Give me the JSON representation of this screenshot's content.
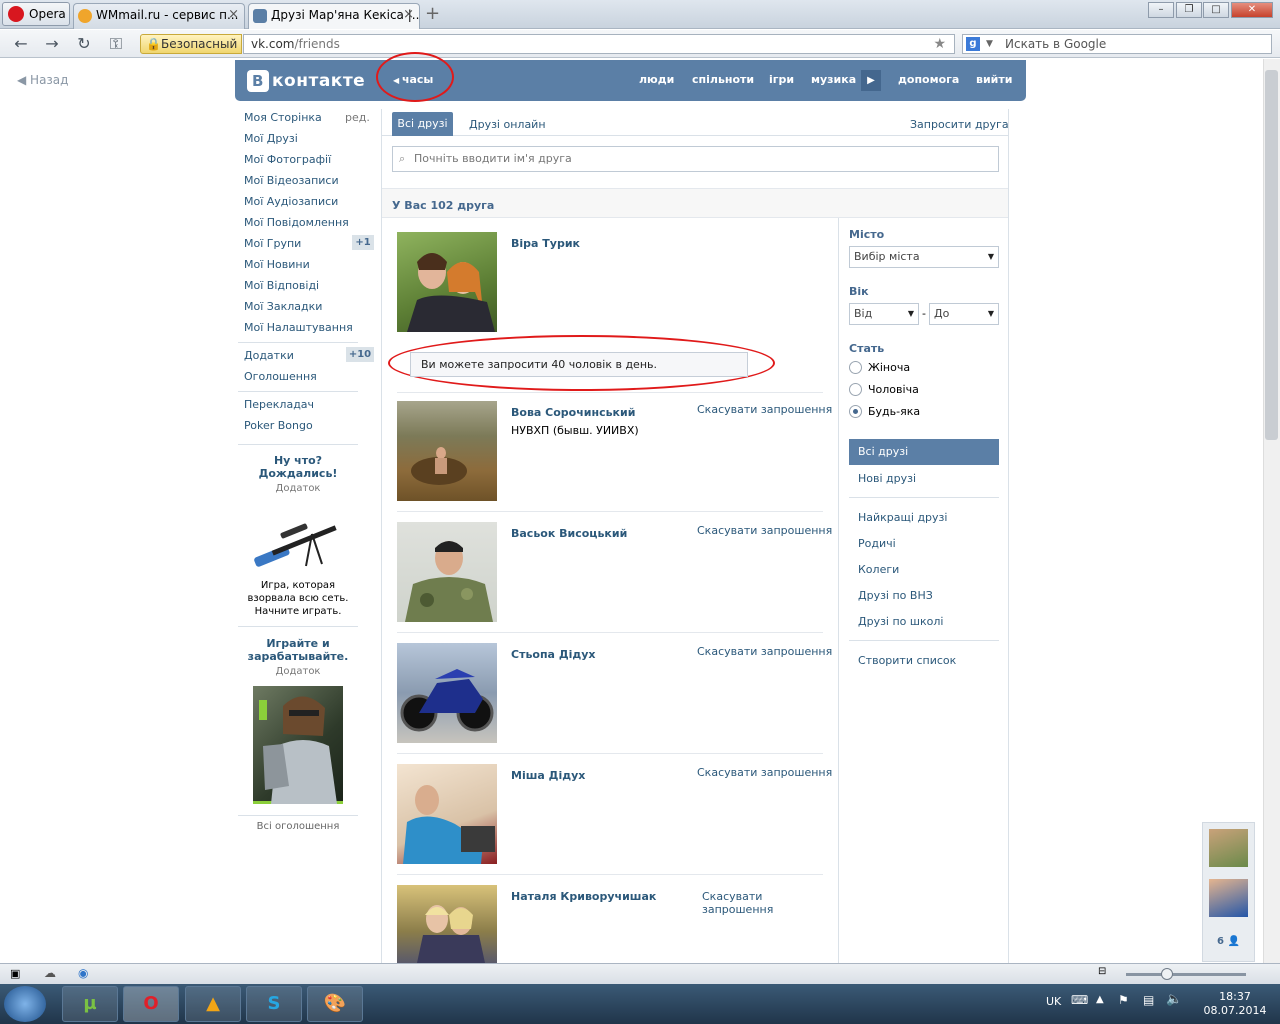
{
  "browser": {
    "opera_button": "Opera",
    "tabs": [
      {
        "label": "WMmail.ru - сервис п..."
      },
      {
        "label": "Друзі Мар'яна Кекіса |..."
      }
    ],
    "secure_label": "Безопасный",
    "address_domain": "vk.com",
    "address_path": "/friends",
    "search_placeholder": "Искать в Google"
  },
  "page": {
    "back_label": "Назад",
    "logo_text": "контакте",
    "logo_letter": "В",
    "status_text": "часы",
    "top_nav": [
      "люди",
      "спільноти",
      "ігри",
      "музика",
      "допомога",
      "вийти"
    ]
  },
  "left_menu": {
    "items": [
      {
        "label": "Моя Сторінка",
        "extra": "ред."
      },
      {
        "label": "Мої Друзі"
      },
      {
        "label": "Мої Фотографії"
      },
      {
        "label": "Мої Відеозаписи"
      },
      {
        "label": "Мої Аудіозаписи"
      },
      {
        "label": "Мої Повідомлення"
      },
      {
        "label": "Мої Групи",
        "badge": "+1"
      },
      {
        "label": "Мої Новини"
      },
      {
        "label": "Мої Відповіді"
      },
      {
        "label": "Мої Закладки"
      },
      {
        "label": "Мої Налаштування"
      }
    ],
    "apps": [
      {
        "label": "Додатки",
        "badge": "+10"
      },
      {
        "label": "Оголошення"
      }
    ],
    "extra": [
      {
        "label": "Перекладач"
      },
      {
        "label": "Poker Bongo"
      }
    ],
    "ads": [
      {
        "title": "Ну что? Дождались!",
        "sub": "Додаток",
        "text": "Игра, которая взорвала всю сеть. Начните играть."
      },
      {
        "title": "Играйте и зарабатывайте.",
        "sub": "Додаток"
      }
    ],
    "all_ads": "Всі оголошення"
  },
  "friends": {
    "tab_all": "Всі друзі",
    "tab_online": "Друзі онлайн",
    "invite_link": "Запросити друга",
    "search_placeholder": "Почніть вводити ім'я друга",
    "count_text": "У Вас 102 друга",
    "notice": "Ви можете запросити 40 чоловік в день.",
    "list": [
      {
        "name": "Віра Турик",
        "subtitle": "",
        "action": ""
      },
      {
        "name": "Вова Сорочинський",
        "subtitle": "НУВХП (бывш. УИИВХ)",
        "action": "Скасувати запрошення"
      },
      {
        "name": "Васьок Висоцький",
        "subtitle": "",
        "action": "Скасувати запрошення"
      },
      {
        "name": "Стьопа Дідух",
        "subtitle": "",
        "action": "Скасувати запрошення"
      },
      {
        "name": "Міша Дідух",
        "subtitle": "",
        "action": "Скасувати запрошення"
      },
      {
        "name": "Наталя Криворучишак",
        "subtitle": "",
        "action": "Скасувати запрошення"
      }
    ]
  },
  "filters": {
    "city_label": "Місто",
    "city_select": "Вибір міста",
    "age_label": "Вік",
    "age_from": "Від",
    "age_to": "До",
    "age_dash": "-",
    "gender_label": "Стать",
    "gender_options": [
      "Жіноча",
      "Чоловіча",
      "Будь-яка"
    ],
    "gender_selected": "Будь-яка",
    "menu": [
      "Всі друзі",
      "Нові друзі",
      "Найкращі друзі",
      "Родичі",
      "Колеги",
      "Друзі по ВНЗ",
      "Друзі по школі",
      "Створити список"
    ]
  },
  "chat": {
    "online_count": "6"
  },
  "taskbar": {
    "lang": "UK",
    "time": "18:37",
    "date": "08.07.2014"
  },
  "colors": {
    "vk_blue": "#5b7fa6",
    "link": "#2b587a",
    "annotation_red": "#e01a1a"
  }
}
